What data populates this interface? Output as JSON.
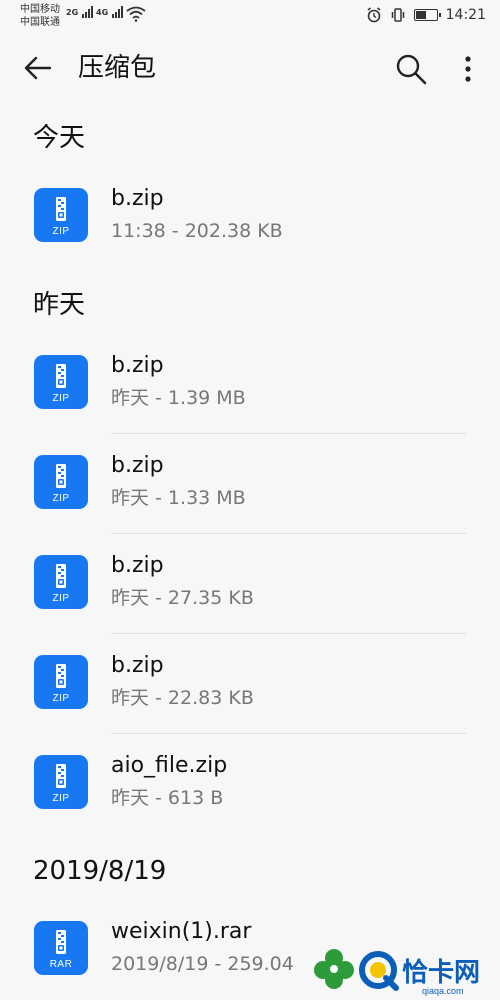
{
  "status_bar": {
    "carrier_1": "中国移动",
    "carrier_2": "中国联通",
    "network_1": "2G",
    "network_2": "4G",
    "time": "14:21",
    "battery_level": 0.5,
    "icons": [
      "alarm-icon",
      "vibrate-icon",
      "battery-icon",
      "wifi-icon"
    ]
  },
  "app_bar": {
    "title": "压缩包",
    "icons": [
      "back-arrow-icon",
      "search-icon",
      "more-vert-icon"
    ]
  },
  "colors": {
    "accent": "#1778f2",
    "background": "#f7f7f7",
    "meta_text": "#777777",
    "divider": "#e1e1e1"
  },
  "sections": [
    {
      "header": "今天",
      "items": [
        {
          "name": "b.zip",
          "meta": "11:38 - 202.38 KB",
          "ext": "ZIP"
        }
      ]
    },
    {
      "header": "昨天",
      "items": [
        {
          "name": "b.zip",
          "meta": "昨天 - 1.39 MB",
          "ext": "ZIP"
        },
        {
          "name": "b.zip",
          "meta": "昨天 - 1.33 MB",
          "ext": "ZIP"
        },
        {
          "name": "b.zip",
          "meta": "昨天 - 27.35 KB",
          "ext": "ZIP"
        },
        {
          "name": "b.zip",
          "meta": "昨天 - 22.83 KB",
          "ext": "ZIP"
        },
        {
          "name": "aio_file.zip",
          "meta": "昨天 - 613 B",
          "ext": "ZIP"
        }
      ]
    },
    {
      "header": "2019/8/19",
      "items": [
        {
          "name": "weixin(1).rar",
          "meta": "2019/8/19 - 259.04",
          "ext": "RAR"
        }
      ]
    }
  ],
  "watermark": {
    "text": "恰卡网",
    "subtext": "qiaqa.com"
  }
}
